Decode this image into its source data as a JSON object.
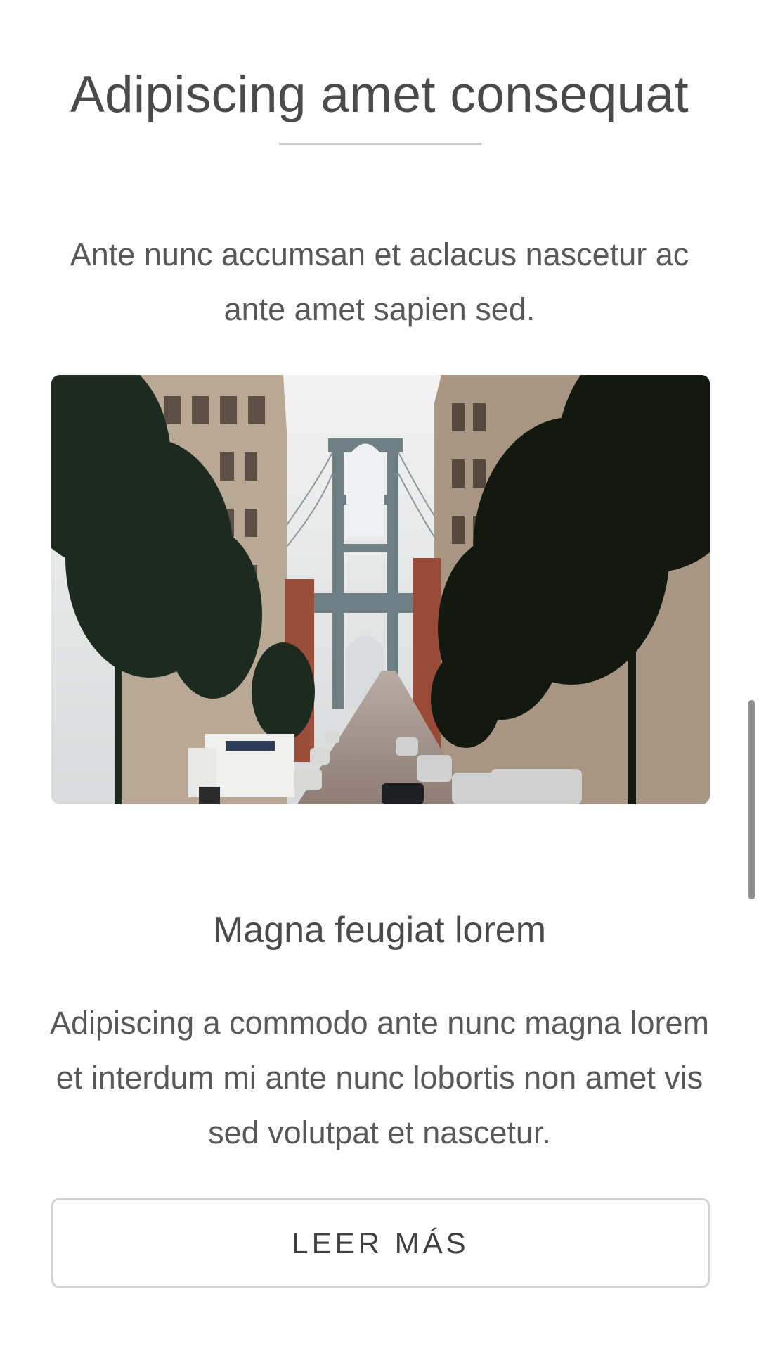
{
  "section": {
    "title": "Adipiscing amet consequat",
    "intro": "Ante nunc accumsan et aclacus nascetur ac ante amet sapien sed."
  },
  "card": {
    "image_alt": "Street view with Manhattan Bridge between brick buildings and trees",
    "title": "Magna feugiat lorem",
    "body": "Adipiscing a commodo ante nunc magna lorem et interdum mi ante nunc lobortis non amet vis sed volutpat et nascetur.",
    "button_label": "LEER MÁS"
  }
}
